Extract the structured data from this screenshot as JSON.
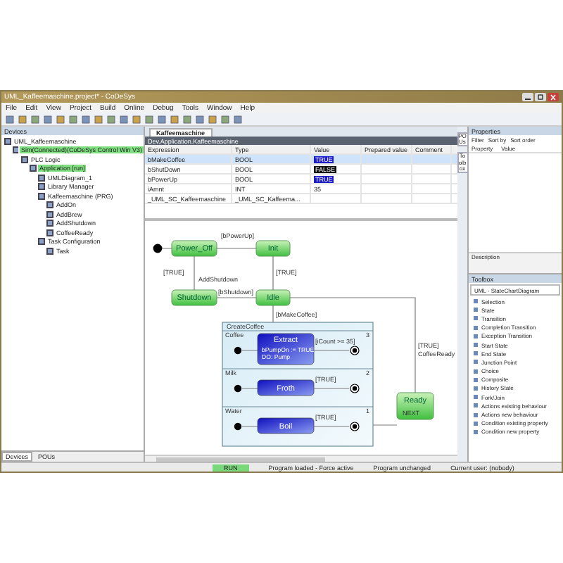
{
  "window": {
    "title": "UML_Kaffeemaschine.project* - CoDeSys"
  },
  "menu": [
    "File",
    "Edit",
    "View",
    "Project",
    "Build",
    "Online",
    "Debug",
    "Tools",
    "Window",
    "Help"
  ],
  "devices": {
    "title": "Devices",
    "tree": [
      {
        "label": "UML_Kaffeemaschine",
        "highlighted": false,
        "children": [
          {
            "label": "Sim(Connected)(CoDeSys Control Win V3)",
            "highlighted": true,
            "children": [
              {
                "label": "PLC Logic",
                "highlighted": false,
                "children": [
                  {
                    "label": "Application [run]",
                    "highlighted": true,
                    "children": [
                      {
                        "label": "UMLDiagram_1",
                        "highlighted": false
                      },
                      {
                        "label": "Library Manager",
                        "highlighted": false
                      },
                      {
                        "label": "Kaffeemaschine (PRG)",
                        "highlighted": false,
                        "children": [
                          {
                            "label": "AddOn",
                            "highlighted": false
                          },
                          {
                            "label": "AddBrew",
                            "highlighted": false
                          },
                          {
                            "label": "AddShutdown",
                            "highlighted": false
                          },
                          {
                            "label": "CoffeeReady",
                            "highlighted": false
                          }
                        ]
                      },
                      {
                        "label": "Task Configuration",
                        "highlighted": false,
                        "children": [
                          {
                            "label": "Task",
                            "highlighted": false
                          }
                        ]
                      }
                    ]
                  }
                ]
              }
            ]
          }
        ]
      }
    ],
    "tabs": [
      {
        "label": "Devices",
        "selected": true
      },
      {
        "label": "POUs",
        "selected": false
      }
    ]
  },
  "editor": {
    "tab": "Kaffeemaschine",
    "path": "Dev.Application.Kaffeemaschine",
    "columns": [
      "Expression",
      "Type",
      "Value",
      "Prepared value",
      "Comment"
    ],
    "rows": [
      {
        "expression": "bMakeCoffee",
        "type": "BOOL",
        "value": "TRUE",
        "kind": "bool",
        "selected": true
      },
      {
        "expression": "bShutDown",
        "type": "BOOL",
        "value": "FALSE",
        "kind": "bool",
        "selected": false
      },
      {
        "expression": "bPowerUp",
        "type": "BOOL",
        "value": "TRUE",
        "kind": "bool",
        "selected": false
      },
      {
        "expression": "iAmnt",
        "type": "INT",
        "value": "35",
        "kind": "plain",
        "selected": false
      },
      {
        "expression": "_UML_SC_Kaffeemaschine",
        "type": "_UML_SC_Kaffeema...",
        "value": "",
        "kind": "struct",
        "selected": false
      }
    ],
    "side_tabs": [
      "POUs",
      "Toolbox"
    ]
  },
  "diagram": {
    "states": [
      {
        "name": "Power_Off",
        "active": false
      },
      {
        "name": "Init",
        "active": false
      },
      {
        "name": "Shutdown",
        "active": false
      },
      {
        "name": "Idle",
        "active": false
      },
      {
        "name": "Ready",
        "active": false
      }
    ],
    "ready_entry": "NEXT",
    "labels": [
      "[bPowerUp]",
      "[TRUE]",
      "AddShutdown",
      "[bShutdown]",
      "[TRUE]",
      "[bMakeCoffee]",
      "[TRUE]",
      "CoffeeReady"
    ],
    "composite": {
      "name": "CreateCoffee",
      "regions": [
        {
          "name": "Coffee",
          "number": "3",
          "state": {
            "name": "Extract",
            "active": true,
            "entries": [
              "bPumpOn := TRUE",
              "DO: Pump"
            ]
          },
          "guard": "[iCount >= 35]"
        },
        {
          "name": "Milk",
          "number": "2",
          "state": {
            "name": "Froth",
            "active": true
          },
          "guard": "[TRUE]"
        },
        {
          "name": "Water",
          "number": "1",
          "state": {
            "name": "Boil",
            "active": true
          },
          "guard": "[TRUE]"
        }
      ]
    }
  },
  "properties": {
    "title": "Properties",
    "tools": [
      "Filter",
      "Sort by",
      "Sort order"
    ],
    "columns": [
      "Property",
      "Value"
    ],
    "description": "Description"
  },
  "toolbox": {
    "title": "Toolbox",
    "category": "UML - StateChartDiagram",
    "items": [
      "Selection",
      "State",
      "Transition",
      "Completion Transition",
      "Exception Transition",
      "Start State",
      "End State",
      "Junction Point",
      "Choice",
      "Composite",
      "History State",
      "Fork/Join",
      "Actions existing behaviour",
      "Actions new behaviour",
      "Condition existing property",
      "Condition new property"
    ]
  },
  "status_bar": [
    {
      "text": "RUN",
      "kind": "run"
    },
    {
      "text": "Program loaded - Force active",
      "kind": "text"
    },
    {
      "text": "Program unchanged",
      "kind": "text"
    },
    {
      "text": "Current user: (nobody)",
      "kind": "text"
    }
  ]
}
